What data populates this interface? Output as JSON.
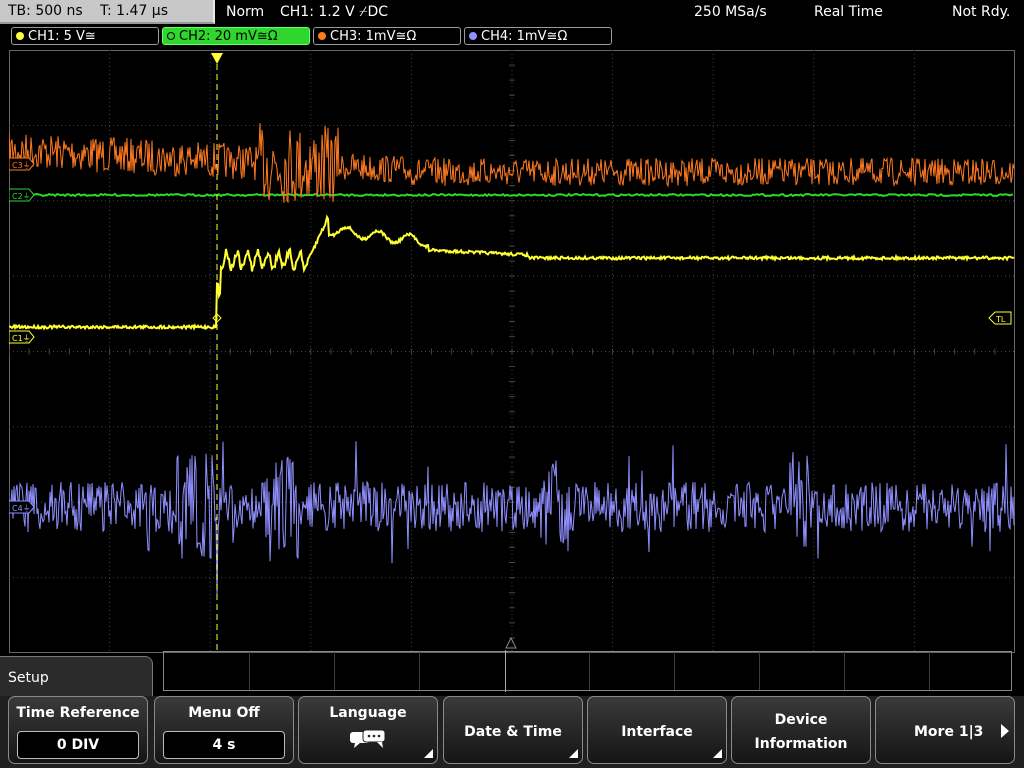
{
  "topbar": {
    "timebase": "TB: 500 ns",
    "trigger_time": "T: 1.47 µs",
    "trigger_mode": "Norm",
    "trigger_info": "CH1: 1.2 V ⌿DC",
    "sample_rate": "250 MSa/s",
    "acq_mode": "Real Time",
    "status": "Not Rdy."
  },
  "channels": [
    {
      "label": "CH1: 5 V≅",
      "color": "#ffff33"
    },
    {
      "label": "CH2: 20 mV≅Ω",
      "color": "#2ed62e"
    },
    {
      "label": "CH3: 1mV≅Ω",
      "color": "#ff7a1f"
    },
    {
      "label": "CH4: 1mV≅Ω",
      "color": "#8f8fff"
    }
  ],
  "display": {
    "markers": {
      "c3": "C3⏚",
      "c2": "C2⏚",
      "c1": "C1⏚",
      "c4": "C4⏚",
      "tl": "TL"
    },
    "grid_color": "#444444"
  },
  "menu": {
    "title": "Setup",
    "softkeys": [
      {
        "label": "Time Reference",
        "value": "0 DIV"
      },
      {
        "label": "Menu Off",
        "value": "4 s"
      },
      {
        "label": "Language",
        "icon": "speech-bubble-icon"
      },
      {
        "label": "Date & Time"
      },
      {
        "label": "Interface"
      },
      {
        "label": "Device",
        "label2": "Information"
      },
      {
        "label": "More 1|3"
      }
    ]
  }
}
